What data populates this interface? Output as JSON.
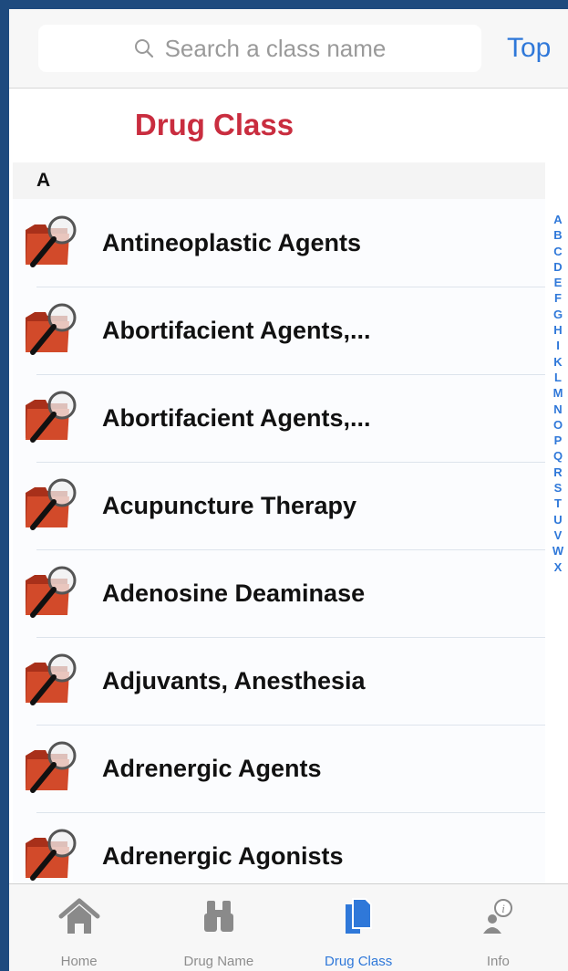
{
  "search": {
    "placeholder": "Search a class name",
    "top_link": "Top"
  },
  "page_title": "Drug Class",
  "section_header": "A",
  "items": [
    {
      "label": "Antineoplastic Agents",
      "icon": "folder-search-icon"
    },
    {
      "label": "Abortifacient Agents,...",
      "icon": "folder-search-icon"
    },
    {
      "label": "Abortifacient Agents,...",
      "icon": "folder-search-icon"
    },
    {
      "label": "Acupuncture Therapy",
      "icon": "folder-search-icon"
    },
    {
      "label": "Adenosine Deaminase",
      "icon": "folder-search-icon"
    },
    {
      "label": "Adjuvants, Anesthesia",
      "icon": "folder-search-icon"
    },
    {
      "label": "Adrenergic Agents",
      "icon": "folder-search-icon"
    },
    {
      "label": "Adrenergic Agonists",
      "icon": "folder-search-icon"
    }
  ],
  "index_letters": [
    "A",
    "B",
    "C",
    "D",
    "E",
    "F",
    "G",
    "H",
    "I",
    "K",
    "L",
    "M",
    "N",
    "O",
    "P",
    "Q",
    "R",
    "S",
    "T",
    "U",
    "V",
    "W",
    "X"
  ],
  "tabs": [
    {
      "label": "Home",
      "icon": "home-icon",
      "active": false
    },
    {
      "label": "Drug Name",
      "icon": "binoculars-icon",
      "active": false
    },
    {
      "label": "Drug Class",
      "icon": "documents-icon",
      "active": true
    },
    {
      "label": "Info",
      "icon": "info-person-icon",
      "active": false
    }
  ],
  "colors": {
    "frame": "#1e4a7e",
    "title": "#c92d3f",
    "accent": "#2f78d9",
    "inactive_tab": "#8e8e8e",
    "folder": "#d24a2a"
  }
}
